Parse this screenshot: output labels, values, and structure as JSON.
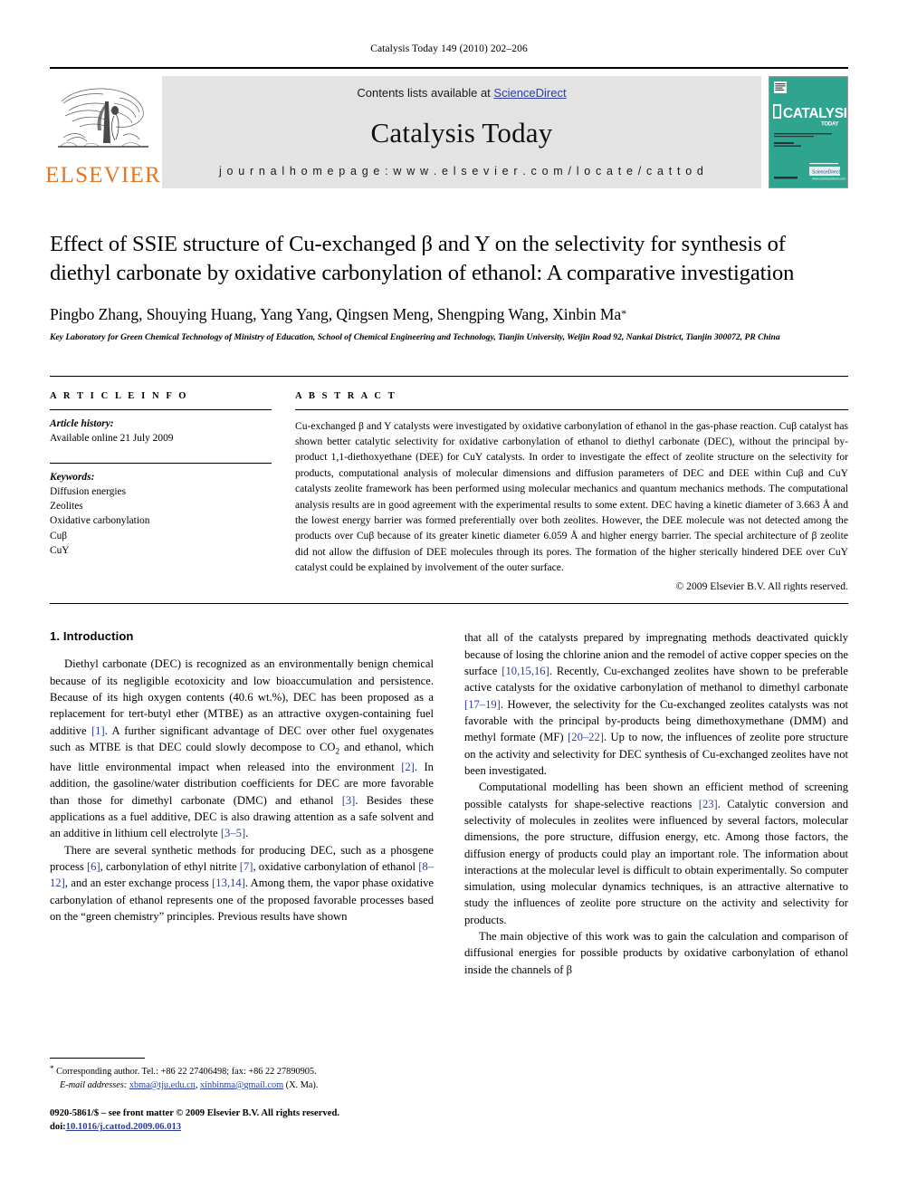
{
  "running_head": "Catalysis Today 149 (2010) 202–206",
  "masthead": {
    "publisher_logo_label": "ELSEVIER",
    "contents_prefix": "Contents lists available at ",
    "contents_link": "ScienceDirect",
    "journal_name": "Catalysis Today",
    "homepage_line": "j o u r n a l   h o m e p a g e :   w w w . e l s e v i e r . c o m / l o c a t e / c a t t o d",
    "cover": {
      "brand": "CATALYSIS",
      "brand_sub": "TODAY",
      "tagline": "An International Journal on Science & Technology of Catalysis",
      "editors": "Editors: ...",
      "available_at": "Available online at",
      "sciencedirect": "ScienceDirect",
      "sd_url": "www.sciencedirect.com",
      "bg_color": "#2fa58f"
    }
  },
  "article": {
    "title": "Effect of SSIE structure of Cu-exchanged β and Y on the selectivity for synthesis of diethyl carbonate by oxidative carbonylation of ethanol: A comparative investigation",
    "authors": "Pingbo Zhang, Shouying Huang, Yang Yang, Qingsen Meng, Shengping Wang, Xinbin Ma",
    "corresponding_marker": "*",
    "affiliation": "Key Laboratory for Green Chemical Technology of Ministry of Education, School of Chemical Engineering and Technology, Tianjin University, Weijin Road 92, Nankai District, Tianjin 300072, PR China"
  },
  "article_info": {
    "heading": "A R T I C L E   I N F O",
    "history_label": "Article history:",
    "history_value": "Available online 21 July 2009",
    "keywords_label": "Keywords:",
    "keywords": [
      "Diffusion energies",
      "Zeolites",
      "Oxidative carbonylation",
      "Cuβ",
      "CuY"
    ]
  },
  "abstract": {
    "heading": "A B S T R A C T",
    "text": "Cu-exchanged β and Y catalysts were investigated by oxidative carbonylation of ethanol in the gas-phase reaction. Cuβ catalyst has shown better catalytic selectivity for oxidative carbonylation of ethanol to diethyl carbonate (DEC), without the principal by-product 1,1-diethoxyethane (DEE) for CuY catalysts. In order to investigate the effect of zeolite structure on the selectivity for products, computational analysis of molecular dimensions and diffusion parameters of DEC and DEE within Cuβ and CuY catalysts zeolite framework has been performed using molecular mechanics and quantum mechanics methods. The computational analysis results are in good agreement with the experimental results to some extent. DEC having a kinetic diameter of 3.663 Å and the lowest energy barrier was formed preferentially over both zeolites. However, the DEE molecule was not detected among the products over Cuβ because of its greater kinetic diameter 6.059 Å and higher energy barrier. The special architecture of β zeolite did not allow the diffusion of DEE molecules through its pores. The formation of the higher sterically hindered DEE over CuY catalyst could be explained by involvement of the outer surface.",
    "copyright": "© 2009 Elsevier B.V. All rights reserved."
  },
  "body": {
    "section_number_title": "1. Introduction",
    "left_paragraphs": [
      "Diethyl carbonate (DEC) is recognized as an environmentally benign chemical because of its negligible ecotoxicity and low bioaccumulation and persistence. Because of its high oxygen contents (40.6 wt.%), DEC has been proposed as a replacement for tert-butyl ether (MTBE) as an attractive oxygen-containing fuel additive [1]. A further significant advantage of DEC over other fuel oxygenates such as MTBE is that DEC could slowly decompose to CO2 and ethanol, which have little environmental impact when released into the environment [2]. In addition, the gasoline/water distribution coefficients for DEC are more favorable than those for dimethyl carbonate (DMC) and ethanol [3]. Besides these applications as a fuel additive, DEC is also drawing attention as a safe solvent and an additive in lithium cell electrolyte [3–5].",
      "There are several synthetic methods for producing DEC, such as a phosgene process [6], carbonylation of ethyl nitrite [7], oxidative carbonylation of ethanol [8–12], and an ester exchange process [13,14]. Among them, the vapor phase oxidative carbonylation of ethanol represents one of the proposed favorable processes based on the “green chemistry” principles. Previous results have shown"
    ],
    "right_paragraphs": [
      "that all of the catalysts prepared by impregnating methods deactivated quickly because of losing the chlorine anion and the remodel of active copper species on the surface [10,15,16]. Recently, Cu-exchanged zeolites have shown to be preferable active catalysts for the oxidative carbonylation of methanol to dimethyl carbonate [17–19]. However, the selectivity for the Cu-exchanged zeolites catalysts was not favorable with the principal by-products being dimethoxymethane (DMM) and methyl formate (MF) [20–22]. Up to now, the influences of zeolite pore structure on the activity and selectivity for DEC synthesis of Cu-exchanged zeolites have not been investigated.",
      "Computational modelling has been shown an efficient method of screening possible catalysts for shape-selective reactions [23]. Catalytic conversion and selectivity of molecules in zeolites were influenced by several factors, molecular dimensions, the pore structure, diffusion energy, etc. Among those factors, the diffusion energy of products could play an important role. The information about interactions at the molecular level is difficult to obtain experimentally. So computer simulation, using molecular dynamics techniques, is an attractive alternative to study the influences of zeolite pore structure on the activity and selectivity for products.",
      "The main objective of this work was to gain the calculation and comparison of diffusional energies for possible products by oxidative carbonylation of ethanol inside the channels of β"
    ]
  },
  "footnote": {
    "corresponding": "Corresponding author. Tel.: +86 22 27406498; fax: +86 22 27890905.",
    "email_label": "E-mail addresses:",
    "email_1": "xbma@tju.edu.cn",
    "email_sep": ", ",
    "email_2": "xinbinma@gmail.com",
    "email_suffix": " (X. Ma)."
  },
  "footer": {
    "issn_line": "0920-5861/$ – see front matter © 2009 Elsevier B.V. All rights reserved.",
    "doi_label": "doi:",
    "doi_value": "10.1016/j.cattod.2009.06.013"
  },
  "colors": {
    "link": "#2d3e9e",
    "elsevier_orange": "#E8751F",
    "masthead_bg": "#e3e3e3",
    "cover_teal": "#2fa58f"
  }
}
